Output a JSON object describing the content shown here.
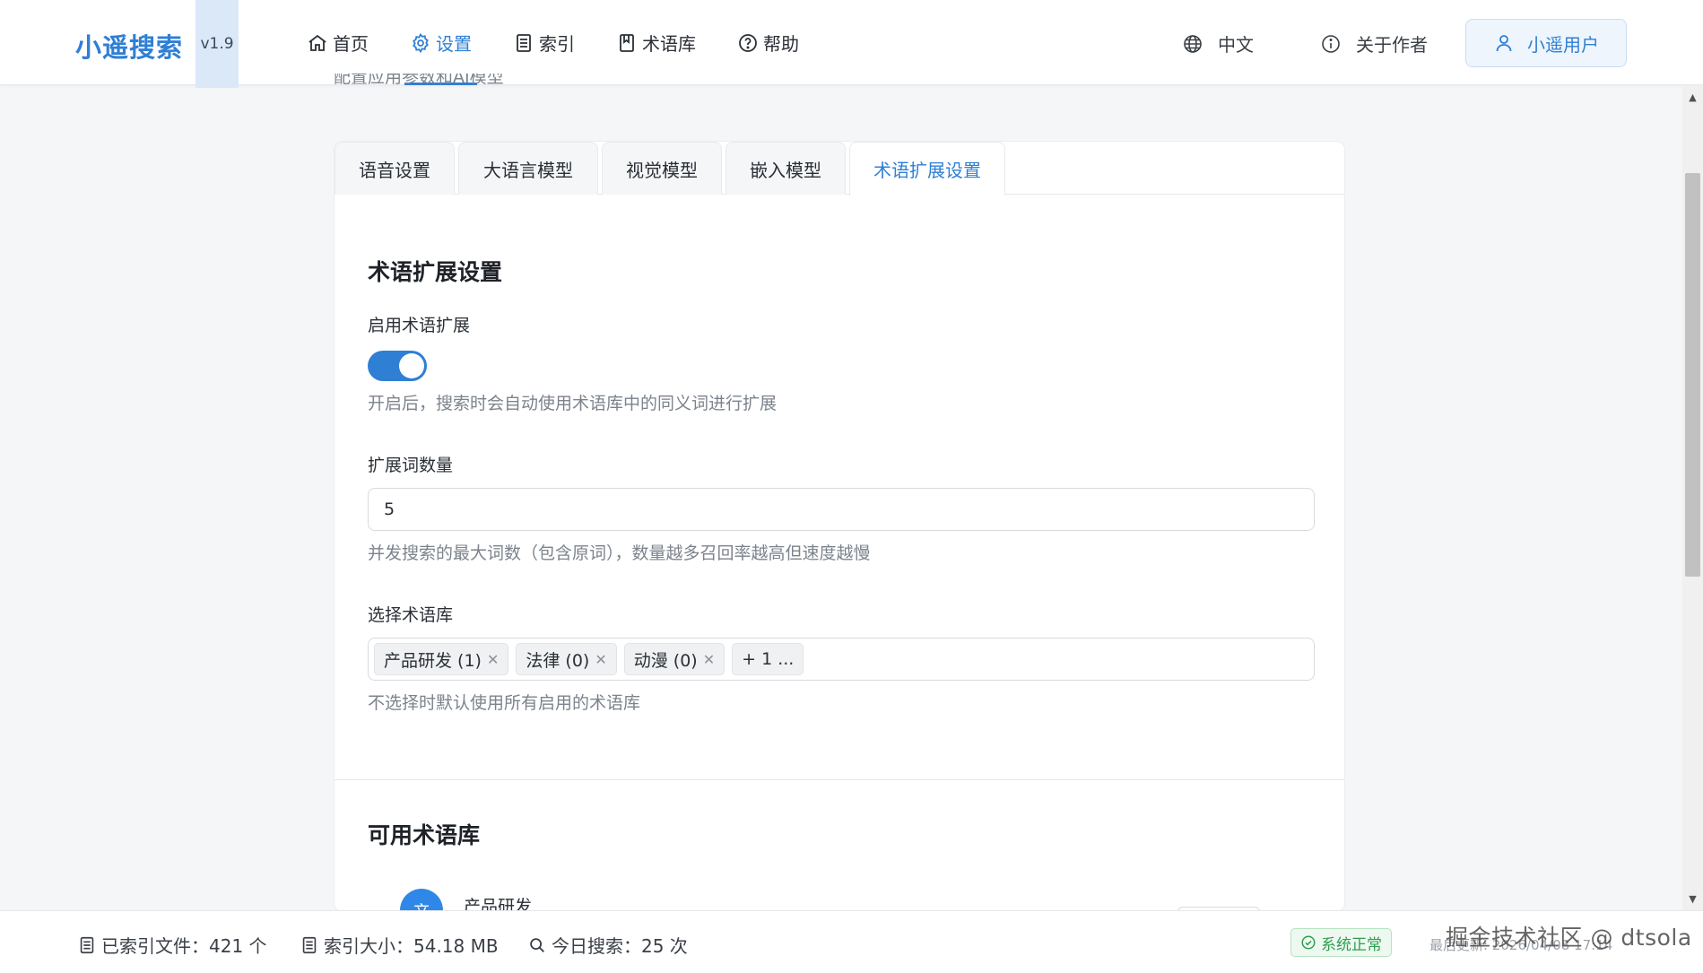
{
  "header": {
    "logo": "小遥搜索",
    "version": "v1.9",
    "nav": [
      {
        "label": "首页",
        "icon": "home-icon"
      },
      {
        "label": "设置",
        "icon": "gear-icon"
      },
      {
        "label": "索引",
        "icon": "list-icon"
      },
      {
        "label": "术语库",
        "icon": "book-icon"
      },
      {
        "label": "帮助",
        "icon": "help-circle-icon"
      }
    ],
    "active_nav": "设置",
    "language": "中文",
    "about": "关于作者",
    "user": "小遥用户"
  },
  "page": {
    "subtitle": "配置应用参数和AI模型"
  },
  "tabs": [
    "语音设置",
    "大语言模型",
    "视觉模型",
    "嵌入模型",
    "术语扩展设置"
  ],
  "active_tab": "术语扩展设置",
  "term_expansion": {
    "section_title": "术语扩展设置",
    "enable_label": "启用术语扩展",
    "enabled": true,
    "enable_hint": "开启后，搜索时会自动使用术语库中的同义词进行扩展",
    "count_label": "扩展词数量",
    "count_value": "5",
    "count_hint": "并发搜索的最大词数（包含原词），数量越多召回率越高但速度越慢",
    "select_label": "选择术语库",
    "selected_tags": [
      "产品研发 (1)",
      "法律 (0)",
      "动漫 (0)"
    ],
    "more_tag": "+ 1 ...",
    "select_hint": "不选择时默认使用所有启用的术语库"
  },
  "available": {
    "section_title": "可用术语库",
    "items": [
      {
        "avatar": "产",
        "name": "产品研发"
      }
    ]
  },
  "footer": {
    "indexed_files": "已索引文件：421 个",
    "index_size": "索引大小：54.18 MB",
    "today_searches": "今日搜索：25 次",
    "status": "系统正常",
    "last_update": "最后更新: 2026/04/08 17:14"
  },
  "watermark": "掘金技术社区 @ dtsola",
  "colors": {
    "accent": "#2f7fd4",
    "status_ok": "#2e9e4f"
  }
}
